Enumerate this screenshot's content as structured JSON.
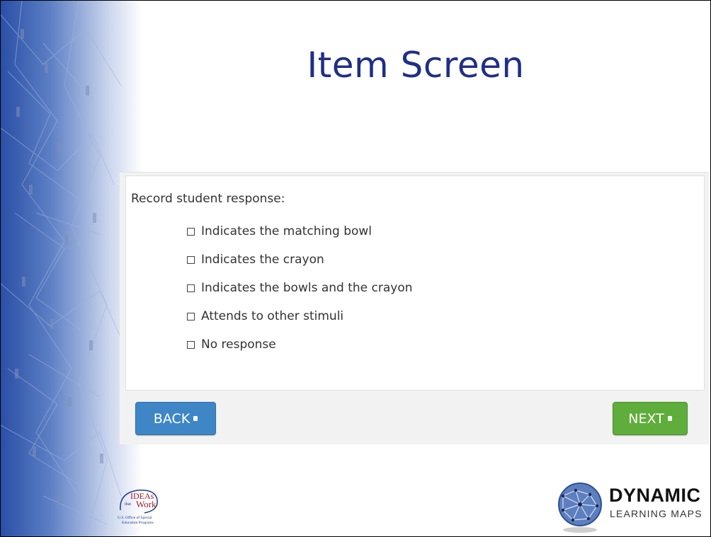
{
  "slide": {
    "title": "Item Screen"
  },
  "item": {
    "prompt": "Record student response:",
    "options": [
      "Indicates the matching bowl",
      "Indicates the crayon",
      "Indicates the bowls and the crayon",
      "Attends to other stimuli",
      "No response"
    ],
    "back_label": "BACK",
    "next_label": "NEXT"
  },
  "logos": {
    "ideas": {
      "line1": "IDEAs",
      "line2": "that",
      "line3": "Work",
      "caption1": "U.S. Office of Special",
      "caption2": "Education Programs"
    },
    "dlm": {
      "line1": "DYNAMIC",
      "line2": "LEARNING MAPS"
    }
  },
  "colors": {
    "title": "#1f2f86",
    "back_button": "#3e86c6",
    "next_button": "#5fad3a",
    "sidebar_blue": "#2b50a8"
  },
  "icons": {
    "sidebar": "network-pattern",
    "checkbox": "checkbox-empty",
    "button": "small-square-icon",
    "dlm": "globe-network-icon"
  }
}
